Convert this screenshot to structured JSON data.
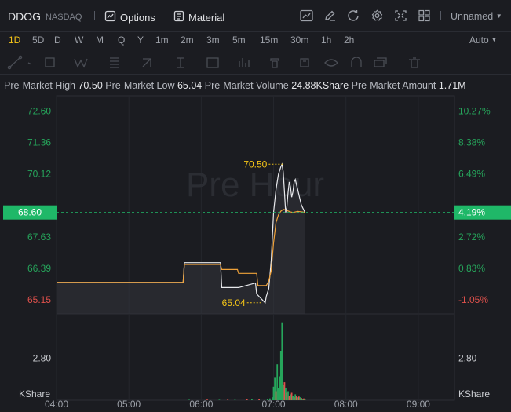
{
  "header": {
    "symbol": "DDOG",
    "exchange": "NASDAQ",
    "options_label": "Options",
    "material_label": "Material",
    "layout_name": "Unnamed"
  },
  "timeframes": [
    "1D",
    "5D",
    "D",
    "W",
    "M",
    "Q",
    "Y",
    "1m",
    "2m",
    "3m",
    "5m",
    "15m",
    "30m",
    "1h",
    "2h"
  ],
  "active_timeframe": "1D",
  "scale_mode": "Auto",
  "stats": {
    "high_label": "Pre-Market High",
    "high_value": "70.50",
    "low_label": "Pre-Market Low",
    "low_value": "65.04",
    "volume_label": "Pre-Market Volume",
    "volume_value": "24.88KShare",
    "amount_label": "Pre-Market Amount",
    "amount_value": "1.71M"
  },
  "watermark": "Pre Hour",
  "colors": {
    "up": "#26a55b",
    "down": "#e0514c",
    "price_line": "#e8e9ec",
    "avg_line": "#f0a23a",
    "accent": "#1fb868",
    "marker": "#f5c518"
  },
  "chart_data": {
    "type": "line",
    "x_ticks": [
      "04:00",
      "05:00",
      "06:00",
      "07:00",
      "08:00",
      "09:00"
    ],
    "x_range": [
      "04:00",
      "09:30"
    ],
    "price_ticks_left": [
      "72.60",
      "71.36",
      "70.12",
      "",
      "67.63",
      "66.39",
      "65.15"
    ],
    "percent_ticks_right": [
      "10.27%",
      "8.38%",
      "6.49%",
      "",
      "2.72%",
      "0.83%",
      "-1.05%"
    ],
    "up_price_ticks": [
      "72.60",
      "71.36",
      "70.12",
      "67.63",
      "66.39"
    ],
    "down_price_ticks": [
      "65.15"
    ],
    "y_range": [
      64.6,
      73.2
    ],
    "current_price": "68.60",
    "current_percent": "4.19%",
    "prev_close": 65.84,
    "high_marker": {
      "time": "07:09",
      "label": "70.50",
      "value": 70.5
    },
    "low_marker": {
      "time": "06:51",
      "label": "65.04",
      "value": 65.04
    },
    "series": [
      {
        "name": "price",
        "x": [
          "04:00",
          "05:45",
          "05:46",
          "06:16",
          "06:17",
          "06:30",
          "06:31",
          "06:45",
          "06:46",
          "06:53",
          "06:54",
          "06:56",
          "06:58",
          "07:00",
          "07:02",
          "07:04",
          "07:06",
          "07:07",
          "07:08",
          "07:09",
          "07:10",
          "07:11",
          "07:12",
          "07:13",
          "07:14",
          "07:15",
          "07:16",
          "07:17",
          "07:18",
          "07:19",
          "07:20",
          "07:21",
          "07:22",
          "07:23",
          "07:24",
          "07:25",
          "07:26"
        ],
        "y": [
          65.84,
          65.84,
          66.62,
          66.62,
          65.64,
          65.64,
          65.64,
          65.82,
          65.39,
          65.04,
          65.3,
          65.6,
          66.7,
          68.6,
          69.5,
          70.1,
          70.4,
          70.5,
          70.2,
          69.4,
          68.6,
          68.8,
          69.4,
          69.8,
          69.6,
          69.2,
          69.4,
          69.8,
          69.9,
          69.7,
          69.5,
          69.3,
          69.1,
          68.9,
          68.8,
          68.7,
          68.6
        ]
      },
      {
        "name": "average",
        "x": [
          "04:00",
          "05:45",
          "05:46",
          "06:16",
          "06:17",
          "06:30",
          "06:31",
          "06:46",
          "06:47",
          "06:54",
          "06:56",
          "06:58",
          "07:00",
          "07:02",
          "07:04",
          "07:06",
          "07:08",
          "07:10",
          "07:12",
          "07:14",
          "07:16",
          "07:18",
          "07:20",
          "07:22",
          "07:24",
          "07:26"
        ],
        "y": [
          65.84,
          65.84,
          66.55,
          66.55,
          66.35,
          66.35,
          66.2,
          66.2,
          65.72,
          65.72,
          65.9,
          66.3,
          67.4,
          68.2,
          68.5,
          68.65,
          68.72,
          68.7,
          68.66,
          68.62,
          68.6,
          68.62,
          68.64,
          68.63,
          68.62,
          68.6
        ]
      }
    ],
    "volume_label": "KShare",
    "volume_tick": "2.80",
    "volume_ylim": [
      0,
      5.5
    ],
    "volume": [
      {
        "time": "05:50",
        "v": 0.03,
        "dir": "up"
      },
      {
        "time": "06:05",
        "v": 0.04,
        "dir": "down"
      },
      {
        "time": "06:15",
        "v": 0.03,
        "dir": "up"
      },
      {
        "time": "06:22",
        "v": 0.04,
        "dir": "down"
      },
      {
        "time": "06:28",
        "v": 0.03,
        "dir": "up"
      },
      {
        "time": "06:38",
        "v": 0.05,
        "dir": "down"
      },
      {
        "time": "06:42",
        "v": 0.06,
        "dir": "up"
      },
      {
        "time": "06:48",
        "v": 0.05,
        "dir": "down"
      },
      {
        "time": "06:55",
        "v": 0.08,
        "dir": "up"
      },
      {
        "time": "06:57",
        "v": 0.12,
        "dir": "up"
      },
      {
        "time": "06:59",
        "v": 0.2,
        "dir": "up"
      },
      {
        "time": "07:00",
        "v": 0.9,
        "dir": "up"
      },
      {
        "time": "07:01",
        "v": 1.5,
        "dir": "up"
      },
      {
        "time": "07:02",
        "v": 0.6,
        "dir": "down"
      },
      {
        "time": "07:03",
        "v": 2.4,
        "dir": "up"
      },
      {
        "time": "07:04",
        "v": 0.8,
        "dir": "up"
      },
      {
        "time": "07:05",
        "v": 1.6,
        "dir": "up"
      },
      {
        "time": "07:06",
        "v": 3.3,
        "dir": "up"
      },
      {
        "time": "07:07",
        "v": 5.2,
        "dir": "up"
      },
      {
        "time": "07:08",
        "v": 1.0,
        "dir": "up"
      },
      {
        "time": "07:09",
        "v": 1.2,
        "dir": "down"
      },
      {
        "time": "07:10",
        "v": 0.8,
        "dir": "up"
      },
      {
        "time": "07:11",
        "v": 0.5,
        "dir": "down"
      },
      {
        "time": "07:12",
        "v": 0.6,
        "dir": "up"
      },
      {
        "time": "07:13",
        "v": 0.3,
        "dir": "down"
      },
      {
        "time": "07:14",
        "v": 0.4,
        "dir": "up"
      },
      {
        "time": "07:15",
        "v": 0.5,
        "dir": "down"
      },
      {
        "time": "07:16",
        "v": 0.3,
        "dir": "up"
      },
      {
        "time": "07:17",
        "v": 0.2,
        "dir": "down"
      },
      {
        "time": "07:18",
        "v": 0.4,
        "dir": "up"
      },
      {
        "time": "07:19",
        "v": 0.3,
        "dir": "down"
      },
      {
        "time": "07:20",
        "v": 0.2,
        "dir": "up"
      },
      {
        "time": "07:21",
        "v": 0.25,
        "dir": "down"
      },
      {
        "time": "07:22",
        "v": 0.2,
        "dir": "up"
      },
      {
        "time": "07:23",
        "v": 0.15,
        "dir": "down"
      },
      {
        "time": "07:24",
        "v": 0.1,
        "dir": "up"
      },
      {
        "time": "07:25",
        "v": 0.12,
        "dir": "down"
      },
      {
        "time": "07:26",
        "v": 0.08,
        "dir": "up"
      }
    ]
  },
  "icons": {
    "options": "options-icon",
    "material": "material-icon",
    "chart_type": "chart-type-icon",
    "draw": "pencil-icon",
    "refresh": "refresh-icon",
    "settings": "gear-icon",
    "fullscreen": "fullscreen-icon",
    "layout": "grid-layout-icon"
  }
}
